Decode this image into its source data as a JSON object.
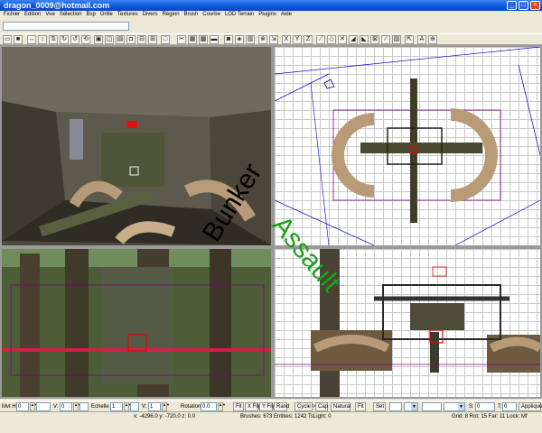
{
  "window": {
    "title": "dragon_0009@hotmail.com"
  },
  "menu": [
    "Fichier",
    "Edition",
    "Vue",
    "Sélection",
    "Bsp",
    "Grille",
    "Textures",
    "Divers",
    "Région",
    "Brush",
    "Courbe",
    "LOD Terrain",
    "Plugins",
    "Aide"
  ],
  "toolbar_icons": [
    "open-icon",
    "save-icon",
    "flip-x-icon",
    "flip-y-icon",
    "flip-z-icon",
    "rotate-x-icon",
    "rotate-y-icon",
    "rotate-z-icon",
    "select-complete-icon",
    "select-touching-icon",
    "select-partial-icon",
    "select-inside-icon",
    "csg-subtract-icon",
    "csg-merge-icon",
    "hollow-icon",
    "clipper-icon",
    "change-views-icon",
    "texture-view-icon",
    "cubic-clip-icon",
    "camera-icon",
    "entity-icon",
    "patch-icon",
    "lock-icon",
    "scale-icon",
    "x-axis-icon",
    "y-axis-icon",
    "z-axis-icon",
    "drag-edges-icon",
    "drag-vertices-icon",
    "cut-icon",
    "bevel-icon",
    "endcap-icon",
    "texture-lock-icon",
    "brush-icon",
    "paint-icon",
    "scale-lock-icon",
    "text-icon",
    "show-entities-icon"
  ],
  "logo": {
    "line1": "Bunker",
    "line2": "Assault",
    "color1": "#000000",
    "color2": "#1aa01a"
  },
  "surface_inspector": {
    "hshift_label": "Mvt H:",
    "hshift_value": "0",
    "vshift_label": "V:",
    "vshift_value": "0",
    "scale_label": "Echelle",
    "scale_h_value": "1",
    "scale_v_label": "V:",
    "scale_v_value": "1",
    "rotation_label": "Rotation",
    "rotation_value": "0.0",
    "buttons": [
      "Fit",
      "X Flip",
      "Y Flip",
      "Rand",
      "Cycle >",
      "Cap",
      "Natural",
      "Fit",
      "Set"
    ],
    "s_label": "S:",
    "s_value": "0",
    "t_label": "T:",
    "t_value": "0",
    "apply_label": "Appliquer"
  },
  "status": {
    "coords": "x:  -4296.0   y:  -720.0   z:  0.0",
    "counts": "Brushes: 673  Entities: 1242  TsLight: 0",
    "grid": "Grid: 8 Rot: 15 Far: 11 Lock: Mf"
  }
}
